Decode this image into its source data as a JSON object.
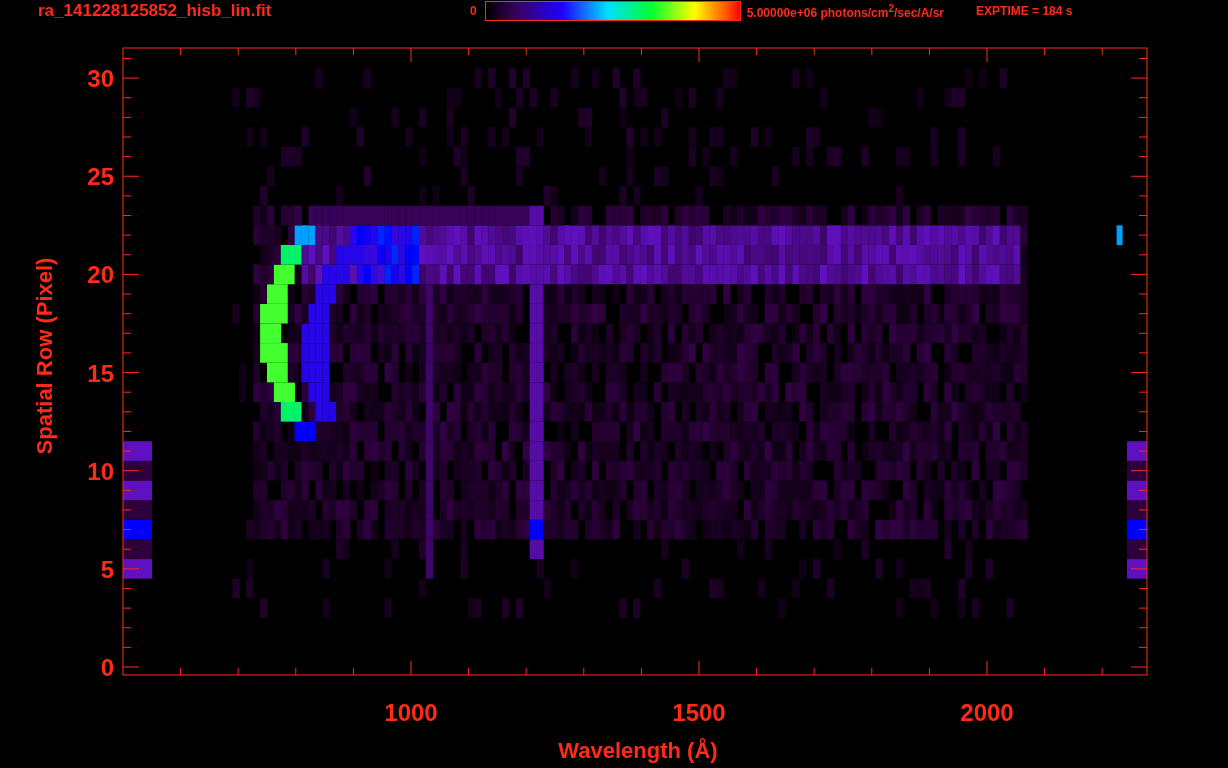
{
  "header": {
    "title": "ra_141228125852_hisb_lin.fit",
    "colorbar": {
      "min_label": "0",
      "max_label": "5.00000e+06 photons/cm$^{2}$/sec/A/sr"
    },
    "exposure": "EXPTIME = 184 s"
  },
  "plot": {
    "xlabel": "Wavelength (Å)",
    "ylabel": "Spatial Row (Pixel)",
    "xticks": [
      "1000",
      "1500",
      "2000"
    ],
    "yticks": [
      "30",
      "25",
      "20",
      "15",
      "10",
      "5",
      "0"
    ]
  }
}
